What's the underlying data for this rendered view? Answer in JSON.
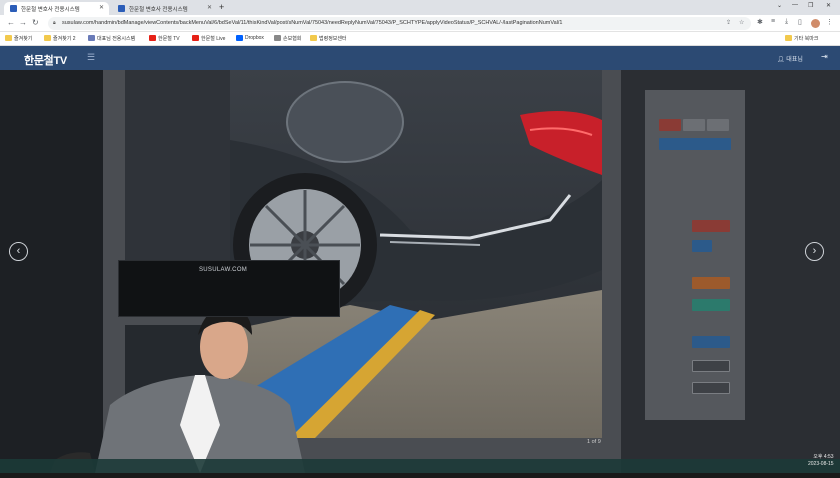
{
  "browser": {
    "tabs": [
      {
        "title": "한문철 변호사 전용시스템",
        "active": true
      },
      {
        "title": "한문철 변호사 전용시스템",
        "active": false
      }
    ],
    "newtab_symbol": "+",
    "window_controls": [
      "⌄",
      "—",
      "❐",
      "✕"
    ],
    "url": "susulaw.com/handmin/bdManage/viewContents/backMenuVal/6/bdSeVal/11/thisKindVal/post/sNumVal/75043/needReplyNumVal/75043/P_SCHTYPE/applyVideoStatus/P_SCHVAL/-/lastPaginationNumVal/1",
    "bookmarks": [
      {
        "label": "즐겨찾기",
        "icon": "folder"
      },
      {
        "label": "즐겨찾기 2",
        "icon": "folder"
      },
      {
        "label": "대표님 전용시스템",
        "icon": "page"
      },
      {
        "label": "한문철 TV",
        "icon": "youtube"
      },
      {
        "label": "한문철 Live",
        "icon": "youtube"
      },
      {
        "label": "Dropbox",
        "icon": "dropbox"
      },
      {
        "label": "손보협회",
        "icon": "generic"
      },
      {
        "label": "법령정보센터",
        "icon": "folder"
      }
    ],
    "other_bookmarks": "기타 북마크"
  },
  "site": {
    "logo": "한문철TV",
    "user_label": "대표님",
    "menu_icon": "hamburger-icon",
    "logout_icon": "logout-icon"
  },
  "lightbox": {
    "counter": "1 of 9",
    "prev_symbol": "‹",
    "next_symbol": "›"
  },
  "presenter": {
    "monitor_label": "SUSULAW.COM"
  },
  "clock": {
    "time": "오후 4:53",
    "date": "2023-08-15"
  },
  "colors": {
    "header": "#2c4a73",
    "red_button": "#c0392b",
    "blue_button": "#2a6db5"
  }
}
